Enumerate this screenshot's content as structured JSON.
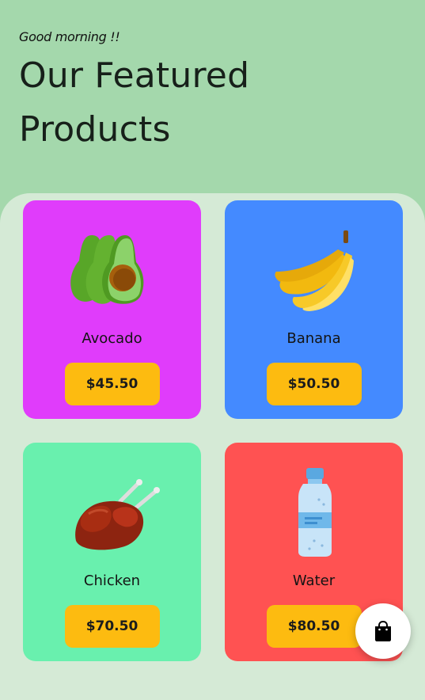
{
  "header": {
    "greeting": "Good morning !!",
    "title": "Our Featured Products"
  },
  "products": [
    {
      "name": "Avocado",
      "price": "$45.50",
      "color": "#e03cfb",
      "icon": "avocado-icon"
    },
    {
      "name": "Banana",
      "price": "$50.50",
      "color": "#448aff",
      "icon": "banana-icon"
    },
    {
      "name": "Chicken",
      "price": "$70.50",
      "color": "#69f0ae",
      "icon": "chicken-icon"
    },
    {
      "name": "Water",
      "price": "$80.50",
      "color": "#ff5252",
      "icon": "water-bottle-icon"
    }
  ],
  "cart": {
    "icon": "shopping-bag-icon"
  },
  "colors": {
    "background": "#a4d8ac",
    "panel": "#d5ead6",
    "price_button": "#fdbb10"
  }
}
